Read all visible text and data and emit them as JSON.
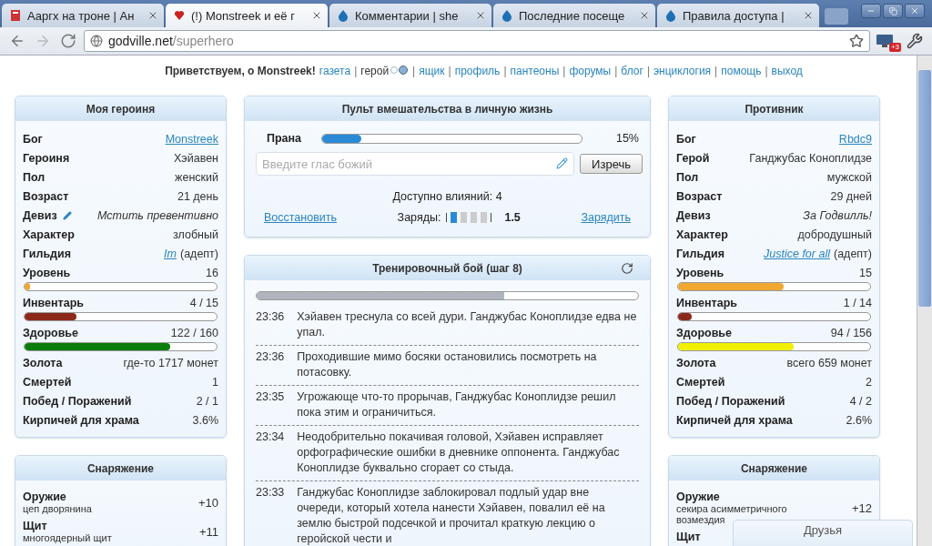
{
  "browser": {
    "tabs": [
      {
        "title": "Ааргх на троне | Ан",
        "selected": false,
        "kind": "book"
      },
      {
        "title": "(!) Monstreek и её г",
        "selected": true,
        "kind": "heart"
      },
      {
        "title": "Комментарии | she",
        "selected": false,
        "kind": "drop"
      },
      {
        "title": "Последние посеще",
        "selected": false,
        "kind": "drop"
      },
      {
        "title": "Правила доступа |",
        "selected": false,
        "kind": "drop"
      }
    ],
    "address": {
      "host": "godville.net",
      "path": "/superhero"
    },
    "extension_badge": "+3"
  },
  "nav": {
    "greeting": "Приветствуем, о Monstreek!",
    "items": [
      {
        "kind": "link",
        "label": "газета"
      },
      {
        "kind": "separator",
        "label": "|"
      },
      {
        "kind": "current",
        "label": "герой"
      },
      {
        "kind": "separator",
        "label": "|"
      },
      {
        "kind": "link",
        "label": "ящик"
      },
      {
        "kind": "separator",
        "label": "|"
      },
      {
        "kind": "link",
        "label": "профиль"
      },
      {
        "kind": "separator",
        "label": "|"
      },
      {
        "kind": "link",
        "label": "пантеоны"
      },
      {
        "kind": "separator",
        "label": "|"
      },
      {
        "kind": "link",
        "label": "форумы"
      },
      {
        "kind": "separator",
        "label": "|"
      },
      {
        "kind": "link",
        "label": "блог"
      },
      {
        "kind": "separator",
        "label": "|"
      },
      {
        "kind": "link",
        "label": "энциклогия"
      },
      {
        "kind": "separator",
        "label": "|"
      },
      {
        "kind": "link",
        "label": "помощь"
      },
      {
        "kind": "separator",
        "label": "|"
      },
      {
        "kind": "link",
        "label": "выход"
      }
    ]
  },
  "hero": {
    "title": "Моя героиня",
    "rows": [
      {
        "kind": "link",
        "label": "Бог",
        "value": "Monstreek"
      },
      {
        "kind": "text",
        "label": "Героиня",
        "value": "Хэйавен"
      },
      {
        "kind": "text",
        "label": "Пол",
        "value": "женский"
      },
      {
        "kind": "text",
        "label": "Возраст",
        "value": "21 день"
      },
      {
        "kind": "italic",
        "label": "Девиз",
        "value": "Мстить превентивно",
        "editable": true
      },
      {
        "kind": "text",
        "label": "Характер",
        "value": "злобный"
      },
      {
        "kind": "guild",
        "label": "Гильдия",
        "value": "Im",
        "suffix": "(адепт)"
      },
      {
        "kind": "bar",
        "label": "Уровень",
        "value": "16",
        "level": 0.03,
        "color": "#f0a830"
      },
      {
        "kind": "bar",
        "label": "Инвентарь",
        "value": "4 / 15",
        "level": 0.27,
        "color": "#8b2a1a"
      },
      {
        "kind": "bar",
        "label": "Здоровье",
        "value": "122 / 160",
        "level": 0.76,
        "color": "#0a7d0a"
      },
      {
        "kind": "text",
        "label": "Золота",
        "value": "где-то 1717 монет"
      },
      {
        "kind": "text",
        "label": "Смертей",
        "value": "1"
      },
      {
        "kind": "text",
        "label": "Побед / Поражений",
        "value": "2 / 1"
      },
      {
        "kind": "text",
        "label": "Кирпичей для храма",
        "value": "3.6%"
      }
    ]
  },
  "hero_equipment": {
    "title": "Снаряжение",
    "items": [
      {
        "slot": "Оружие",
        "item": "цеп дворянина",
        "bonus": "+10"
      },
      {
        "slot": "Щит",
        "item": "многоядерный щит",
        "bonus": "+11"
      }
    ]
  },
  "control": {
    "title": "Пульт вмешательства в личную жизнь",
    "prana": {
      "label": "Прана",
      "level": 0.15,
      "reading": "15%"
    },
    "voice": {
      "placeholder": "Введите глас божий",
      "button": "Изречь"
    },
    "influence": "Доступно влияний: 4",
    "restore": "Восстановить",
    "charges": {
      "label": "Заряды:",
      "slots": [
        {
          "filled": true
        },
        {
          "filled": false
        },
        {
          "filled": false
        },
        {
          "filled": false
        }
      ],
      "reading": "1.5"
    },
    "charge": "Зарядить"
  },
  "battle": {
    "title": "Тренировочный бой (шаг 8)",
    "progress": {
      "level": 0.65
    },
    "log": [
      {
        "time": "23:36",
        "text": "Хэйавен треснула со всей дури. Ганджубас Коноплидзе едва не упал."
      },
      {
        "time": "23:36",
        "text": "Проходившие мимо босяки остановились посмотреть на потасовку."
      },
      {
        "time": "23:35",
        "text": "Угрожающе что-то прорычав, Ганджубас Коноплидзе решил пока этим и ограничиться."
      },
      {
        "time": "23:34",
        "text": "Неодобрительно покачивая головой, Хэйавен исправляет орфографические ошибки в дневнике оппонента. Ганджубас Коноплидзе буквально сгорает со стыда."
      },
      {
        "time": "23:33",
        "text": "Ганджубас Коноплидзе заблокировал подлый удар вне очереди, который хотела нанести Хэйавен, повалил её на землю быстрой подсечкой и прочитал краткую лекцию о геройской чести и"
      }
    ]
  },
  "opponent": {
    "title": "Противник",
    "rows": [
      {
        "kind": "link",
        "label": "Бог",
        "value": "Rbdc9"
      },
      {
        "kind": "text",
        "label": "Герой",
        "value": "Ганджубас Коноплидзе"
      },
      {
        "kind": "text",
        "label": "Пол",
        "value": "мужской"
      },
      {
        "kind": "text",
        "label": "Возраст",
        "value": "29 дней"
      },
      {
        "kind": "italic",
        "label": "Девиз",
        "value": "За Годвилль!",
        "editable": false
      },
      {
        "kind": "text",
        "label": "Характер",
        "value": "добродушный"
      },
      {
        "kind": "guild",
        "label": "Гильдия",
        "value": "Justice for all",
        "suffix": "(адепт)"
      },
      {
        "kind": "bar",
        "label": "Уровень",
        "value": "15",
        "level": 0.55,
        "color": "#f0a830"
      },
      {
        "kind": "bar",
        "label": "Инвентарь",
        "value": "1 / 14",
        "level": 0.07,
        "color": "#8b2a1a"
      },
      {
        "kind": "bar",
        "label": "Здоровье",
        "value": "94 / 156",
        "level": 0.6,
        "color": "#f0f000"
      },
      {
        "kind": "text",
        "label": "Золота",
        "value": "всего 659 монет"
      },
      {
        "kind": "text",
        "label": "Смертей",
        "value": "2"
      },
      {
        "kind": "text",
        "label": "Побед / Поражений",
        "value": "4 / 2"
      },
      {
        "kind": "text",
        "label": "Кирпичей для храма",
        "value": "2.6%"
      }
    ]
  },
  "opponent_equipment": {
    "title": "Снаряжение",
    "items": [
      {
        "slot": "Оружие",
        "item": "секира асимметричного возмездия",
        "bonus": "+12"
      },
      {
        "slot": "Щит"
      }
    ]
  },
  "friends": {
    "label": "Друзья"
  }
}
